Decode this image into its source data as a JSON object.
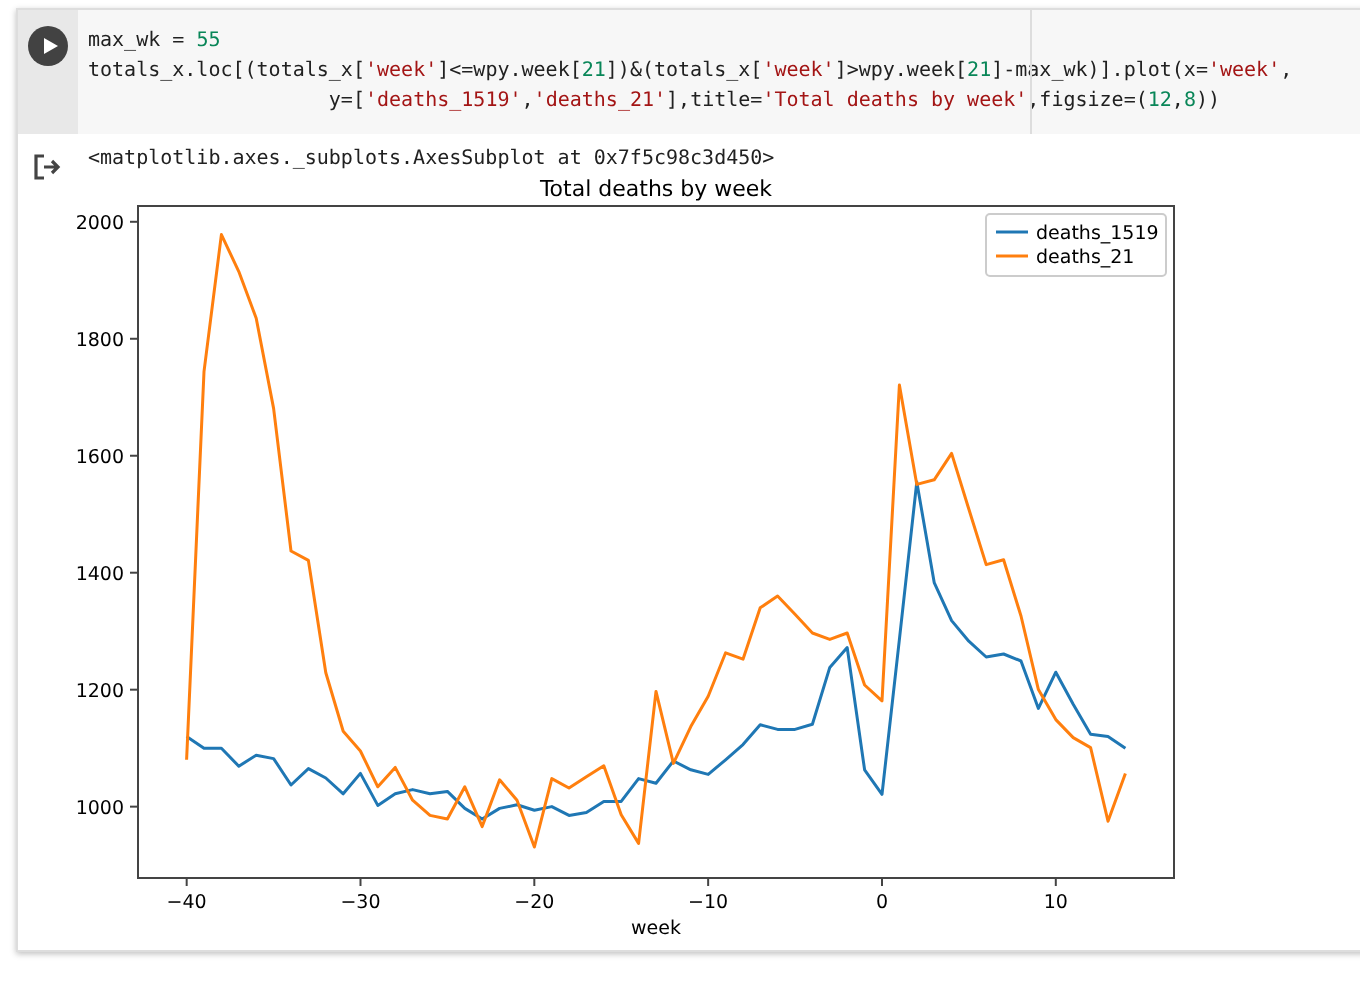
{
  "cell": {
    "code": [
      [
        {
          "text": "max_wk = ",
          "kind": "plain"
        },
        {
          "text": "55",
          "kind": "number"
        }
      ],
      [
        {
          "text": "totals_x.loc[(totals_x[",
          "kind": "plain"
        },
        {
          "text": "'week'",
          "kind": "string"
        },
        {
          "text": "]<=wpy.week[",
          "kind": "plain"
        },
        {
          "text": "21",
          "kind": "number"
        },
        {
          "text": "])&(totals_x[",
          "kind": "plain"
        },
        {
          "text": "'week'",
          "kind": "string"
        },
        {
          "text": "]>wpy.week[",
          "kind": "plain"
        },
        {
          "text": "21",
          "kind": "number"
        },
        {
          "text": "]-max_wk)].plot(x=",
          "kind": "plain"
        },
        {
          "text": "'week'",
          "kind": "string"
        },
        {
          "text": ",",
          "kind": "plain"
        }
      ],
      [
        {
          "text": "                    y=[",
          "kind": "plain"
        },
        {
          "text": "'deaths_1519'",
          "kind": "string"
        },
        {
          "text": ",",
          "kind": "plain"
        },
        {
          "text": "'deaths_21'",
          "kind": "string"
        },
        {
          "text": "],title=",
          "kind": "plain"
        },
        {
          "text": "'Total deaths by week'",
          "kind": "string"
        },
        {
          "text": ",figsize=(",
          "kind": "plain"
        },
        {
          "text": "12",
          "kind": "number"
        },
        {
          "text": ",",
          "kind": "plain"
        },
        {
          "text": "8",
          "kind": "number"
        },
        {
          "text": "))",
          "kind": "plain"
        }
      ]
    ],
    "output_text": "<matplotlib.axes._subplots.AxesSubplot at 0x7f5c98c3d450>",
    "chart_data": {
      "type": "line",
      "title": "Total deaths by week",
      "xlabel": "week",
      "legend": true,
      "x": [
        -40,
        -39,
        -38,
        -37,
        -36,
        -35,
        -34,
        -33,
        -32,
        -31,
        -30,
        -29,
        -28,
        -27,
        -26,
        -25,
        -24,
        -23,
        -22,
        -21,
        -20,
        -19,
        -18,
        -17,
        -16,
        -15,
        -14,
        -13,
        -12,
        -11,
        -10,
        -9,
        -8,
        -7,
        -6,
        -5,
        -4,
        -3,
        -2,
        -1,
        0,
        1,
        2,
        3,
        4,
        5,
        6,
        7,
        8,
        9,
        10,
        11,
        12,
        13,
        14
      ],
      "series": [
        {
          "name": "deaths_1519",
          "color": "#1f77b4",
          "values": [
            1120,
            1100,
            1100,
            1069,
            1088,
            1082,
            1037,
            1065,
            1049,
            1022,
            1057,
            1002,
            1022,
            1029,
            1022,
            1026,
            997,
            979,
            997,
            1003,
            994,
            1000,
            985,
            990,
            1009,
            1009,
            1048,
            1040,
            1078,
            1063,
            1055,
            1080,
            1106,
            1140,
            1132,
            1132,
            1141,
            1238,
            1272,
            1063,
            1021,
            1286,
            1555,
            1383,
            1318,
            1283,
            1256,
            1261,
            1249,
            1168,
            1230,
            1175,
            1124,
            1120,
            1100
          ]
        },
        {
          "name": "deaths_21",
          "color": "#ff7f0e",
          "values": [
            1080,
            1744,
            1978,
            1915,
            1835,
            1681,
            1437,
            1421,
            1229,
            1129,
            1095,
            1034,
            1067,
            1011,
            985,
            979,
            1034,
            966,
            1046,
            1011,
            931,
            1048,
            1032,
            1051,
            1070,
            986,
            937,
            1197,
            1074,
            1137,
            1189,
            1263,
            1252,
            1340,
            1360,
            1329,
            1297,
            1286,
            1297,
            1208,
            1181,
            1721,
            1551,
            1559,
            1604,
            1509,
            1414,
            1422,
            1326,
            1200,
            1149,
            1118,
            1101,
            975,
            1057
          ]
        }
      ],
      "xlim": [
        -42.8,
        16.8
      ],
      "ylim": [
        878,
        2027
      ],
      "xticks": [
        {
          "value": -40,
          "label": "−40"
        },
        {
          "value": -30,
          "label": "−30"
        },
        {
          "value": -20,
          "label": "−20"
        },
        {
          "value": -10,
          "label": "−10"
        },
        0,
        10
      ],
      "yticks": [
        1000,
        1200,
        1400,
        1600,
        1800,
        2000
      ]
    }
  }
}
